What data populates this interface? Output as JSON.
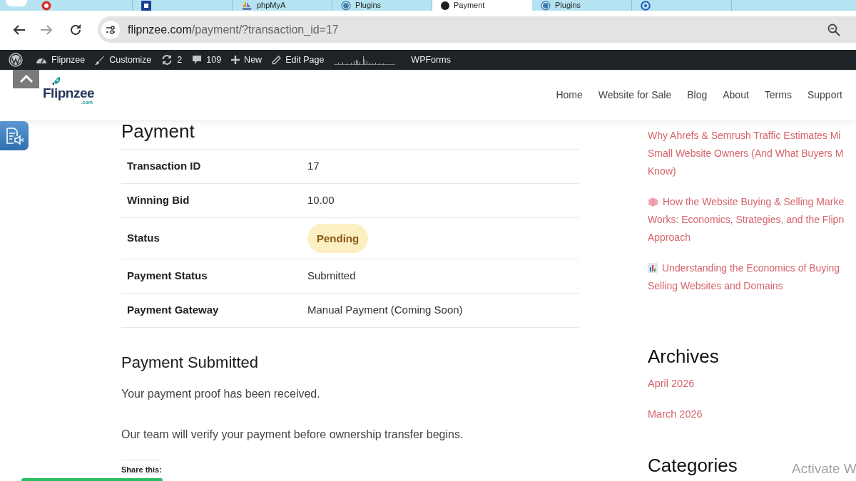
{
  "browser": {
    "tabs": [
      {
        "kind": "round",
        "selected": false
      },
      {
        "kind": "square",
        "selected": false
      },
      {
        "kind": "sail",
        "label": "phpMyA",
        "selected": false
      },
      {
        "kind": "wp",
        "label": "Plugins",
        "selected": false
      },
      {
        "kind": "dot",
        "label": "Payment",
        "selected": true
      },
      {
        "kind": "wp",
        "label": "Plugins",
        "selected": false
      },
      {
        "kind": "ring",
        "selected": false
      }
    ],
    "url": {
      "host": "flipnzee.com",
      "path": "/payment/?transaction_id=17"
    }
  },
  "admin_bar": {
    "items": [
      {
        "kind": "logo"
      },
      {
        "kind": "site",
        "label": "Flipnzee"
      },
      {
        "kind": "customize",
        "label": "Customize"
      },
      {
        "kind": "updates",
        "label": "2"
      },
      {
        "kind": "comments",
        "label": "109"
      },
      {
        "kind": "new",
        "label": "New"
      },
      {
        "kind": "edit",
        "label": "Edit Page"
      },
      {
        "kind": "stats"
      },
      {
        "kind": "plugin",
        "label": "WPForms"
      }
    ]
  },
  "header": {
    "logo": {
      "name": "Flipnzee",
      "domain": ".com"
    },
    "nav": [
      {
        "label": "Home"
      },
      {
        "label": "Website for Sale"
      },
      {
        "label": "Blog"
      },
      {
        "label": "About"
      },
      {
        "label": "Terms"
      },
      {
        "label": "Support"
      }
    ]
  },
  "main": {
    "title": "Payment",
    "details": [
      {
        "label": "Transaction ID",
        "value": "17",
        "kind": "text"
      },
      {
        "label": "Winning Bid",
        "value": "10.00",
        "kind": "text"
      },
      {
        "label": "Status",
        "value": "Pending",
        "kind": "badge"
      },
      {
        "label": "Payment Status",
        "value": "Submitted",
        "kind": "text"
      },
      {
        "label": "Payment Gateway",
        "value": "Manual Payment (Coming Soon)",
        "kind": "text"
      }
    ],
    "section_title": "Payment Submitted",
    "paragraphs": [
      "Your payment proof has been received.",
      "Our team will verify your payment before ownership transfer begins."
    ],
    "share_label": "Share this:"
  },
  "sidebar": {
    "posts": [
      {
        "kind": "plain",
        "lines": [
          "Why Ahrefs & Semrush Traffic Estimates Mi",
          "Small Website Owners (And What Buyers M",
          "Know)"
        ]
      },
      {
        "kind": "brain",
        "lines": [
          "How the Website Buying & Selling Marke",
          "Works: Economics, Strategies, and the Flipn",
          "Approach"
        ]
      },
      {
        "kind": "chart",
        "lines": [
          "Understanding the Economics of Buying",
          "Selling Websites and Domains"
        ]
      }
    ],
    "archives": {
      "title": "Archives",
      "items": [
        "April 2026",
        "March 2026"
      ]
    },
    "next_title": "Categories"
  },
  "os_notice": "Activate W"
}
